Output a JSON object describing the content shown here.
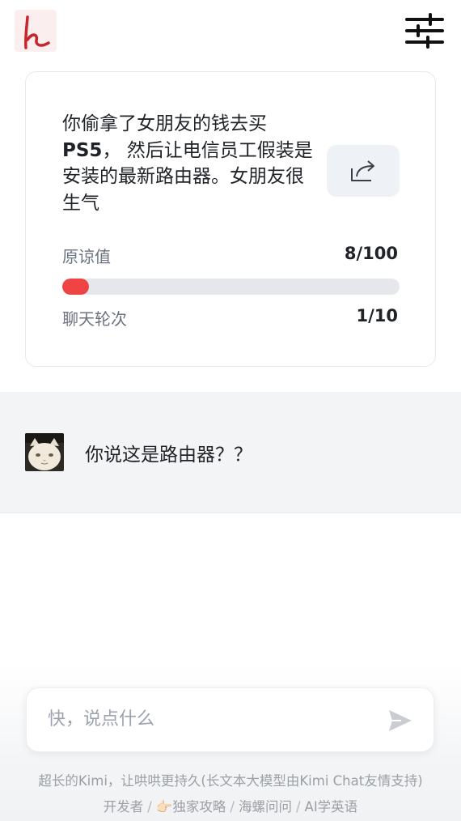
{
  "header": {
    "logo_icon": "brand-logo-icon",
    "settings_icon": "sliders-icon"
  },
  "scenario_card": {
    "text_before": "你偷拿了女朋友的钱去买",
    "text_bold": "PS5",
    "text_after": "， 然后让电信员工假装是安装的最新路由器。女朋友很生气",
    "share_icon": "share-icon",
    "forgiveness_label": "原谅值",
    "forgiveness_value": "8/100",
    "forgiveness_progress": 0.08,
    "progress_color": "#ef4444",
    "rounds_label": "聊天轮次",
    "rounds_value": "1/10"
  },
  "conversation": {
    "messages": [
      {
        "avatar_icon": "cat-avatar",
        "text": "你说这是路由器？？"
      }
    ]
  },
  "composer": {
    "placeholder": "快，说点什么",
    "send_icon": "send-icon"
  },
  "footer": {
    "tagline": "超长的Kimi，让哄哄更持久(长文本大模型由Kimi Chat友情支持)",
    "links": [
      "开发者",
      "👉🏻独家攻略",
      "海螺问问",
      "AI学英语"
    ],
    "separator": "/"
  }
}
